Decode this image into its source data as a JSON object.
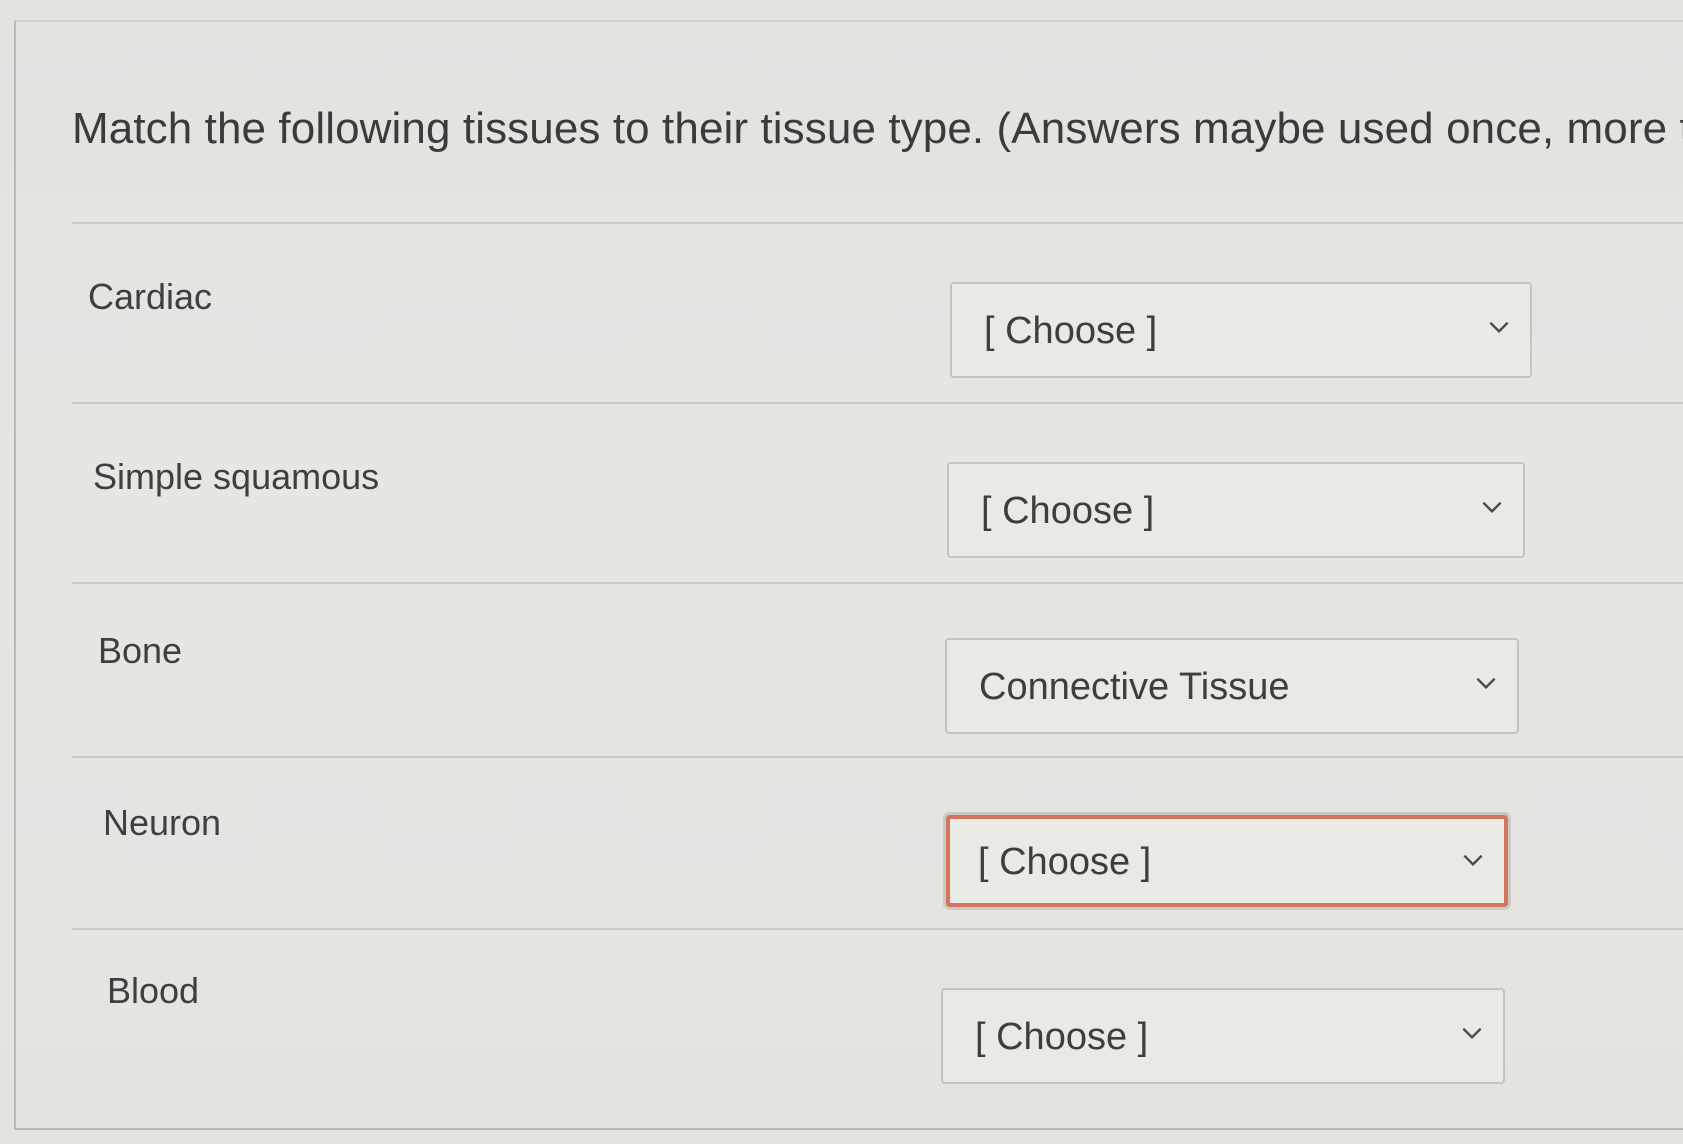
{
  "question": {
    "text": "Match the following tissues to their tissue type. (Answers maybe used once, more than"
  },
  "rows": [
    {
      "label": "Cardiac",
      "selected": "[ Choose ]",
      "invalid": false
    },
    {
      "label": "Simple squamous",
      "selected": "[ Choose ]",
      "invalid": false
    },
    {
      "label": "Bone",
      "selected": "Connective Tissue",
      "invalid": false
    },
    {
      "label": "Neuron",
      "selected": "[ Choose ]",
      "invalid": true
    },
    {
      "label": "Blood",
      "selected": "[ Choose ]",
      "invalid": false
    }
  ],
  "colors": {
    "invalid_border": "#d4745c",
    "text": "#3e3e3e"
  },
  "icons": {
    "dropdown": "chevron-down-icon"
  }
}
